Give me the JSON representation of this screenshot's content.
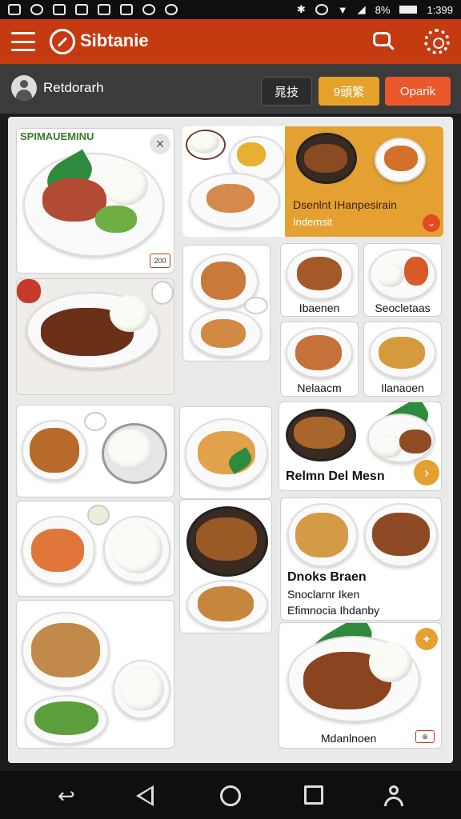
{
  "status_bar": {
    "time": "1:399",
    "battery": "8%"
  },
  "app_bar": {
    "title": "Sibtanie",
    "menu_icon": "menu-icon",
    "search_icon": "search-icon",
    "settings_icon": "settings-icon"
  },
  "sub_bar": {
    "location": "Retdorarh",
    "pills": [
      "晁技",
      "9頭繁",
      "Oparik"
    ]
  },
  "cards": {
    "top_left_title": "SPIMAUEMINU",
    "top_left_badge": "200",
    "featured_title": "Dsenlnt IHanpesirain",
    "featured_sub": "Indemsit",
    "grid_small_1": "Ibaenen",
    "grid_small_2": "Seocletaas",
    "grid_small_3": "Nelaacm",
    "grid_small_4": "Ilanaoen",
    "wide_card_title": "Relmn Del Mesn",
    "info_title": "Dnoks Braen",
    "info_line1": "Snoclarnr Iken",
    "info_line2": "Efimnocia Ihdanby",
    "bottom_right_caption": "Mdanlnoen"
  },
  "nav_bar": {
    "back": "↩"
  }
}
